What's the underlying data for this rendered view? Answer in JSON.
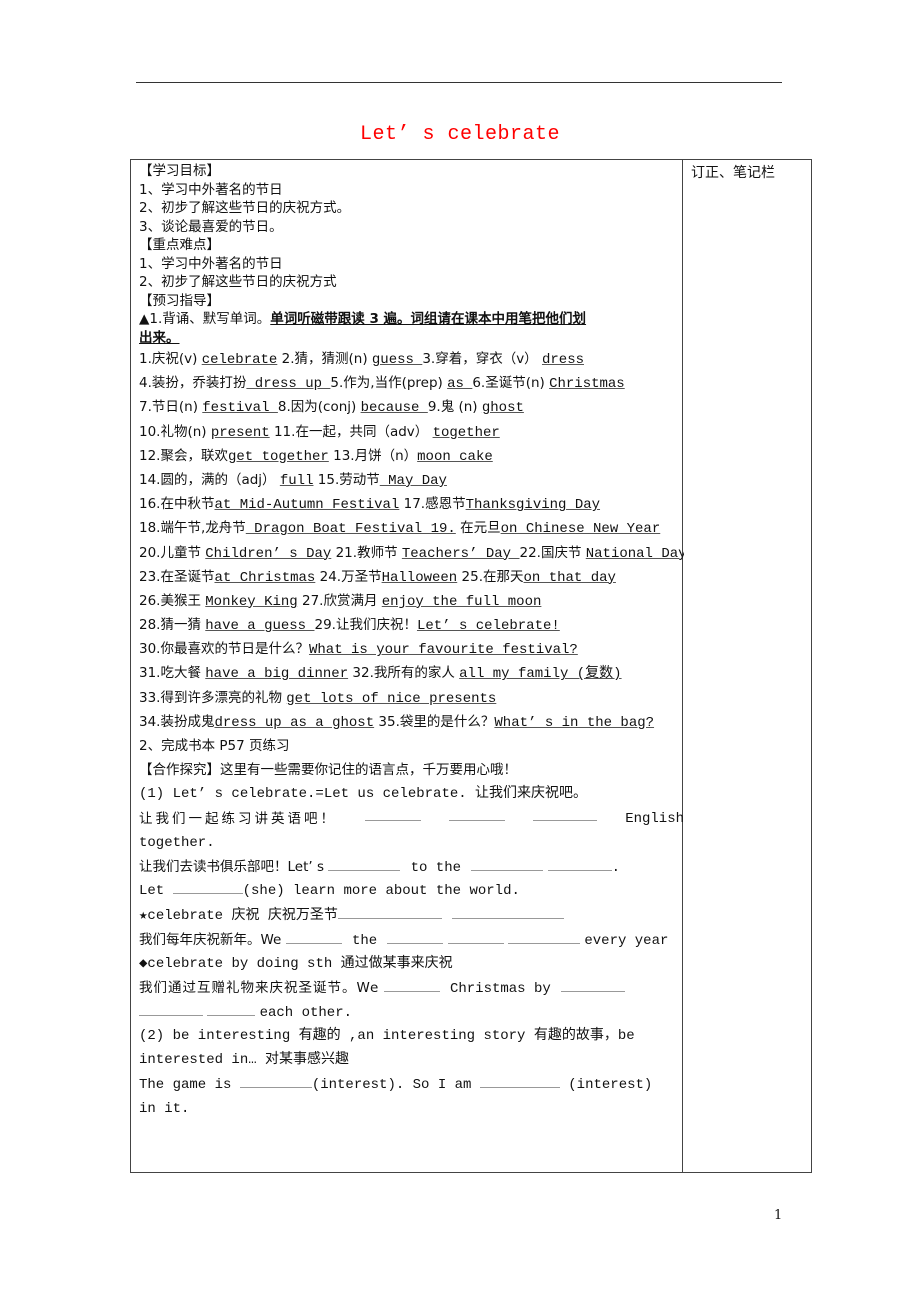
{
  "document": {
    "title": "Let’ s celebrate",
    "page_number": "1",
    "notes_column_header": "订正、笔记栏"
  },
  "objectives": {
    "heading": "【学习目标】",
    "items": [
      "1、学习中外著名的节日",
      "2、初步了解这些节日的庆祝方式。",
      "3、谈论最喜爱的节日。"
    ]
  },
  "key_points": {
    "heading": "【重点难点】",
    "items": [
      "1、学习中外著名的节日",
      "2、初步了解这些节日的庆祝方式"
    ]
  },
  "preview": {
    "heading": "【预习指导】",
    "task1_prefix": "▲1.背诵、默写单词。",
    "task1_emphasis_a": "单词听磁带跟读 3 遍。词组请在课本中用笔把他们划",
    "task1_emphasis_b": "出来。",
    "vocab": [
      {
        "n": "1.",
        "zh": "庆祝(v) ",
        "en": "celebrate"
      },
      {
        "n": "2.",
        "zh": "猜，猜测(n) ",
        "en": "guess "
      },
      {
        "n": "3.",
        "zh": "穿着，穿衣（v） ",
        "en": " dress"
      },
      {
        "n": "4.",
        "zh": "装扮，乔装打扮",
        "en": " dress up  "
      },
      {
        "n": "5.",
        "zh": "作为,当作(prep) ",
        "en": " as "
      },
      {
        "n": "6.",
        "zh": "圣诞节(n) ",
        "en": "Christmas"
      },
      {
        "n": "7.",
        "zh": "节日(n) ",
        "en": " festival "
      },
      {
        "n": "8.",
        "zh": "因为(conj) ",
        "en": "because  "
      },
      {
        "n": "9.",
        "zh": "鬼 (n)  ",
        "en": "ghost"
      },
      {
        "n": "10.",
        "zh": "礼物(n) ",
        "en": "present"
      },
      {
        "n": "11.",
        "zh": "在一起，共同（adv） ",
        "en": "together"
      },
      {
        "n": "12.",
        "zh": "聚会，联欢",
        "en": "get together"
      },
      {
        "n": "13.",
        "zh": "月饼（n）",
        "en": "moon cake"
      },
      {
        "n": "14.",
        "zh": "圆的，满的（adj） ",
        "en": "full"
      },
      {
        "n": "15.",
        "zh": "劳动节",
        "en": " May Day      "
      },
      {
        "n": "16.",
        "zh": "在中秋节",
        "en": "at Mid-Autumn Festival"
      },
      {
        "n": "17.",
        "zh": "感恩节",
        "en": "Thanksgiving Day  "
      },
      {
        "n": "18.",
        "zh": "端午节,龙舟节",
        "en": " Dragon Boat Festival  19."
      },
      {
        "n": "",
        "zh": "在元旦",
        "en": "on Chinese New Year"
      },
      {
        "n": "20.",
        "zh": "儿童节 ",
        "en": "Children’ s Day"
      },
      {
        "n": "21.",
        "zh": "教师节 ",
        "en": "Teachers’  Day  "
      },
      {
        "n": "22.",
        "zh": "国庆节 ",
        "en": "National Day  "
      },
      {
        "n": "23.",
        "zh": "在圣诞节",
        "en": "at Christmas"
      },
      {
        "n": "24.",
        "zh": "万圣节",
        "en": "Halloween"
      },
      {
        "n": "25.",
        "zh": "在那天",
        "en": "on that day"
      },
      {
        "n": "26.",
        "zh": "美猴王 ",
        "en": "Monkey King"
      },
      {
        "n": "27.",
        "zh": "欣赏满月 ",
        "en": "enjoy the full moon"
      },
      {
        "n": "28.",
        "zh": "猜一猜 ",
        "en": "have a guess "
      },
      {
        "n": "29.",
        "zh": "让我们庆祝！",
        "en": "Let’ s celebrate!"
      },
      {
        "n": "30.",
        "zh": "你最喜欢的节日是什么？",
        "en": "What is your favourite festival?"
      },
      {
        "n": "31.",
        "zh": "吃大餐 ",
        "en": "have a big dinner"
      },
      {
        "n": "32.",
        "zh": "我所有的家人 ",
        "en": "all my family (复数)"
      },
      {
        "n": "33.",
        "zh": "得到许多漂亮的礼物 ",
        "en": "get lots of nice presents"
      },
      {
        "n": "34.",
        "zh": "装扮成鬼",
        "en": "dress up as a ghost"
      },
      {
        "n": "35.",
        "zh": "袋里的是什么？",
        "en": "What’ s in the bag?"
      }
    ],
    "task2": "2、完成书本 P57 页练习"
  },
  "cooperation": {
    "heading": "【合作探究】这里有一些需要你记住的语言点，千万要用心哦！",
    "point1": " (1) Let’ s celebrate.=Let us celebrate. 让我们来庆祝吧。",
    "ex1_zh": "让我们一起练习讲英语吧！",
    "ex1_en_tail": "English",
    "ex1_line2": "together.",
    "ex2_zh": "让我们去读书俱乐部吧！Let’ s",
    "ex2_mid": "to the",
    "ex3_a": "Let",
    "ex3_b": "(she) learn more about the world.",
    "star_line": "★celebrate  庆祝  庆祝万圣节",
    "ex4_zh": "我们每年庆祝新年。We",
    "ex4_the": "the",
    "ex4_tail": "every  year",
    "diamond_line": "◆celebrate by doing sth 通过做某事来庆祝",
    "ex5_zh": "我们通过互赠礼物来庆祝圣诞节。We",
    "ex5_mid": "Christmas by",
    "ex5_tail": "each other.",
    "point2_a": "(2) be interesting 有趣的 ,an interesting story 有趣的故事，be",
    "point2_b": "interested in… 对某事感兴趣",
    "ex6_a": "The game is",
    "ex6_b": "(interest). So I am",
    "ex6_c": "(interest)",
    "ex6_d": "in it."
  }
}
